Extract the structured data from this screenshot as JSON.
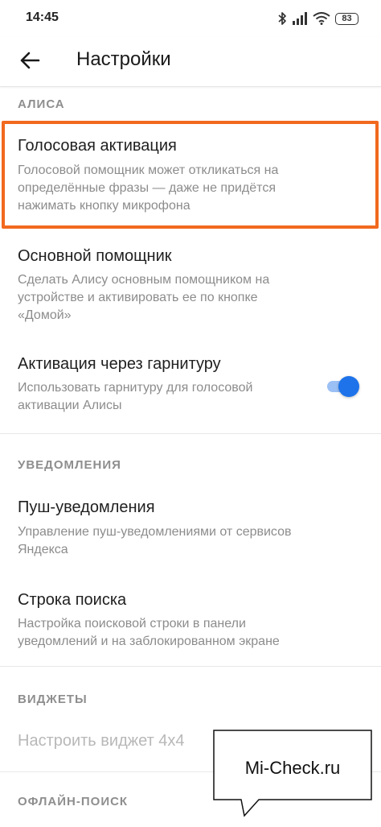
{
  "status_bar": {
    "time": "14:45",
    "battery": "83",
    "icons": [
      "bluetooth-icon",
      "signal-icon",
      "wifi-icon",
      "battery-icon"
    ]
  },
  "app_bar": {
    "back_icon": "arrow-left-icon",
    "title": "Настройки"
  },
  "sections": {
    "alice": {
      "header": "АЛИСА",
      "voice_activation": {
        "title": "Голосовая активация",
        "desc": [
          "Голосовой помощник может откликаться на",
          "определённые фразы — даже не придётся",
          "нажимать кнопку микрофона"
        ]
      },
      "main_assistant": {
        "title": "Основной помощник",
        "desc": [
          "Сделать Алису основным помощником на",
          "устройстве и активировать ее по кнопке",
          "«Домой»"
        ]
      },
      "headset_activation": {
        "title": "Активация через гарнитуру",
        "desc": [
          "Использовать гарнитуру для голосовой",
          "активации Алисы"
        ],
        "toggle_on": true
      }
    },
    "notifications": {
      "header": "УВЕДОМЛЕНИЯ",
      "push": {
        "title": "Пуш-уведомления",
        "desc": [
          "Управление пуш-уведомлениями от сервисов",
          "Яндекса"
        ]
      },
      "search_bar": {
        "title": "Строка поиска",
        "desc": [
          "Настройка поисковой строки в панели",
          "уведомлений и на заблокированном экране"
        ]
      }
    },
    "widgets": {
      "header": "ВИДЖЕТЫ",
      "configure": {
        "title": "Настроить виджет 4x4"
      }
    },
    "offline_search": {
      "header": "ОФЛАЙН-ПОИСК"
    }
  },
  "colors": {
    "highlight": "#f2691f",
    "toggle_knob": "#1e73ea",
    "toggle_track": "#9bc0f5"
  },
  "watermark": {
    "text": "Mi-Check.ru"
  }
}
